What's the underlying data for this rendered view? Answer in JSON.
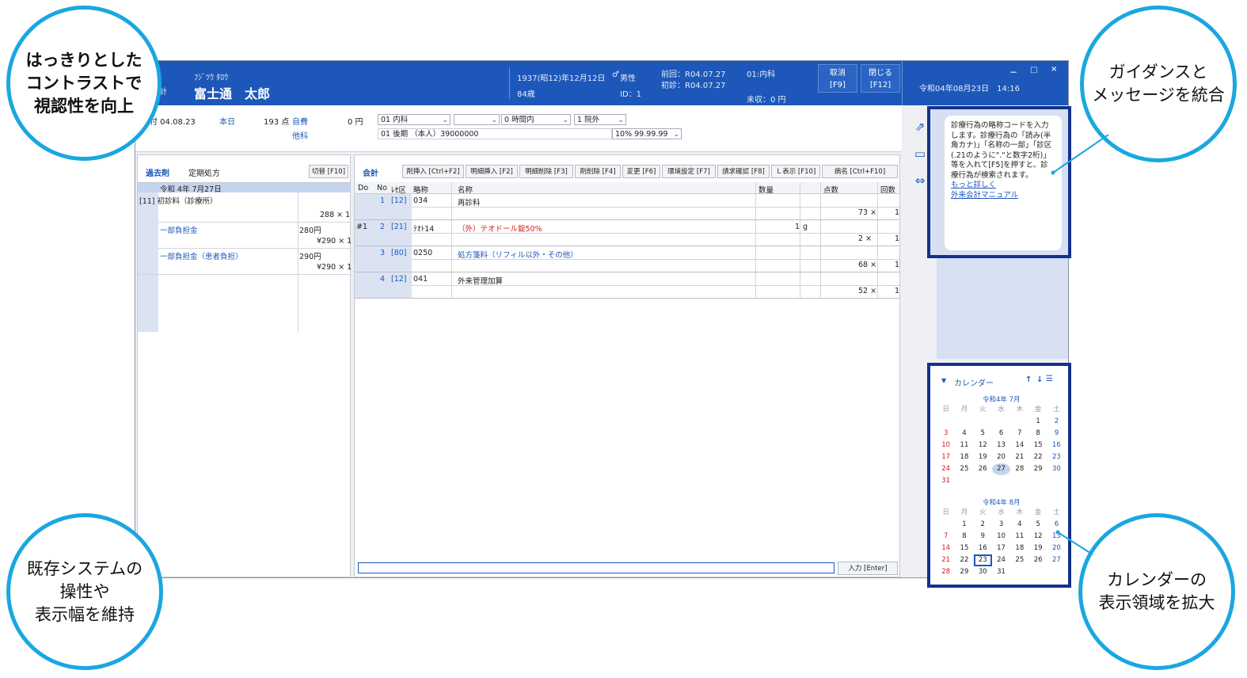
{
  "callouts": {
    "top_left": "はっきりとした\nコントラストで\n視認性を向上",
    "top_right": "ガイダンスと\nメッセージを統合",
    "bottom_left": "既存システムの\n操性や\n表示幅を維持",
    "bottom_right": "カレンダーの\n表示領域を拡大"
  },
  "header": {
    "kana": "ﾌｼﾞﾂｳ ﾀﾛｳ",
    "name": "富士通　太郎",
    "birth": "1937(昭12)年12月12日",
    "age": "84歳",
    "sex": "男性",
    "id": "ID：1",
    "prev_visit": "前回：R04.07.27",
    "first_visit": "初診：R04.07.27",
    "dept": "01:内科",
    "unpaid": "未収：0 円",
    "cancel_btn": "取消\n[F9]",
    "close_btn": "閉じる\n[F12]",
    "datetime": "令和04年08月23日　14:16",
    "left_tag": "計",
    "win_min": "－",
    "win_max": "□",
    "win_close": "×"
  },
  "info_row": {
    "date": "付 04.08.23",
    "today": "本日",
    "points": "193 点",
    "self_pay": "自費",
    "yen": "0 円",
    "other": "他科",
    "dept_select": "01 内科",
    "blank_select": "",
    "time_select": "0 時間内",
    "out_select": "1 院外",
    "insurance": "01 後期 （本人）39000000",
    "ratio_select": "10% 99.99.99"
  },
  "left_panel": {
    "tab_past": "過去剤",
    "tab_regular": "定期処方",
    "switch_btn": "切替 [F10]",
    "date_row": "令和 4年 7月27日",
    "rows": [
      {
        "label": "[11] 初診料（診療所）",
        "value": "288 ×  1"
      },
      {
        "label": "一部負担金",
        "sub": "280円",
        "value": "¥290 ×  1"
      },
      {
        "label": "一部負担金（患者負担）",
        "sub": "290円",
        "value": "¥290 ×  1"
      }
    ]
  },
  "center_panel": {
    "title": "会計",
    "toolbar": [
      "剤挿入 [Ctrl+F2]",
      "明細挿入 [F2]",
      "明細削除 [F3]",
      "剤削除 [F4]",
      "変更 [F6]",
      "環境設定 [F7]",
      "請求確認 [F8]",
      "Ｌ表示 [F10]",
      "病名 [Ctrl+F10]"
    ],
    "columns": [
      "Do",
      "No",
      "ﾚｾ区",
      "略称",
      "名称",
      "数量",
      "点数",
      "回数"
    ],
    "rows": [
      {
        "do": "",
        "no": "1",
        "rese": "[12]",
        "abbr": "034",
        "name": "再診料",
        "qty": "",
        "unit": "",
        "points": "73 ×",
        "times": "1",
        "red": false,
        "blue": false
      },
      {
        "do": "#1",
        "no": "2",
        "rese": "[21]",
        "abbr": "ﾃｵﾄ14",
        "name": "（外）テオドール錠50%",
        "qty": "1",
        "unit": "g",
        "points": "2 ×",
        "times": "1",
        "red": true,
        "blue": false
      },
      {
        "do": "",
        "no": "3",
        "rese": "[80]",
        "abbr": "0250",
        "name": "処方箋料（リフィル以外・その他）",
        "qty": "",
        "unit": "",
        "points": "68 ×",
        "times": "1",
        "red": false,
        "blue": true
      },
      {
        "do": "",
        "no": "4",
        "rese": "[12]",
        "abbr": "041",
        "name": "外来管理加算",
        "qty": "",
        "unit": "",
        "points": "52 ×",
        "times": "1",
        "red": false,
        "blue": false
      }
    ],
    "input_placeholder": "",
    "enter_btn": "入力 [Enter]"
  },
  "guidance": {
    "text": "診療行為の略称コードを入力します。診療行為の「読み(半角カナ)」「名称の一部」「診区(.21のように\".\"と数字2桁)」等を入れて[F5]を押すと、診療行為が検索されます。",
    "link_more": "もっと詳しく",
    "link_manual": "外来会計マニュアル"
  },
  "calendar": {
    "title": "カレンダー",
    "weekdays": [
      "日",
      "月",
      "火",
      "水",
      "木",
      "金",
      "土"
    ],
    "months": [
      {
        "label": "令和4年 7月",
        "offset": 5,
        "days": 31,
        "highlight": 27
      },
      {
        "label": "令和4年 8月",
        "offset": 1,
        "days": 31,
        "selected": 23
      }
    ]
  }
}
